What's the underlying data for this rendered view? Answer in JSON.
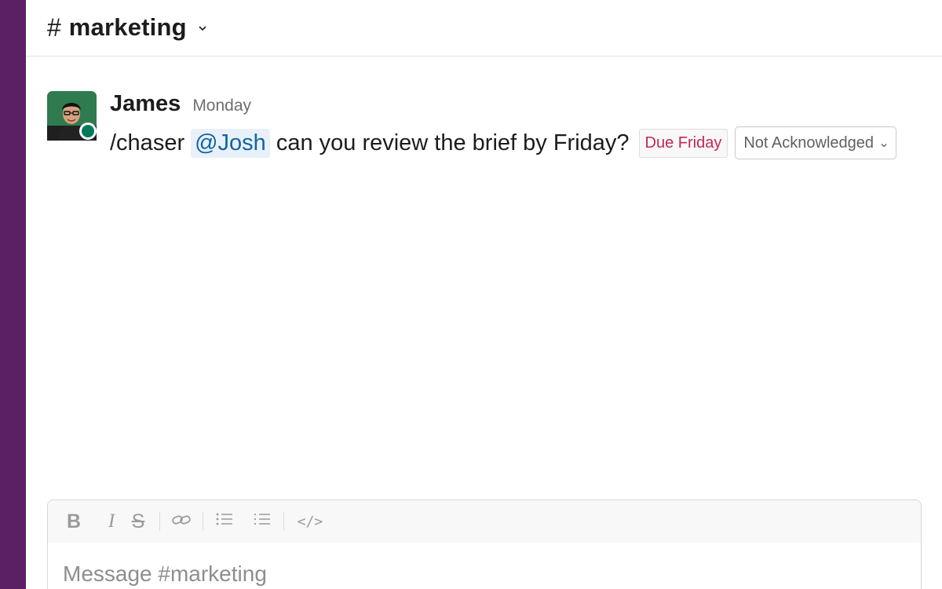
{
  "channel": {
    "hash_symbol": "#",
    "name": "marketing"
  },
  "message": {
    "author": "James",
    "timestamp": "Monday",
    "command": "/chaser",
    "mention": "@Josh",
    "text": "can you review the brief by Friday?",
    "due_badge": "Due Friday",
    "status_select": {
      "selected": "Not Acknowledged"
    }
  },
  "composer": {
    "toolbar": {
      "bold": "B",
      "italic": "I",
      "strike": "S",
      "code": "</>"
    },
    "placeholder": "Message #marketing"
  },
  "colors": {
    "sidebar": "#5b1f63",
    "mention_text": "#1264a3",
    "mention_bg": "#e8f1f9",
    "due_badge_text": "#c1275a",
    "presence": "#007a5a"
  },
  "icons": {
    "channel_chevron": "chevron-down-icon",
    "ack_chevron": "chevron-down-icon",
    "presence": "presence-indicator-icon",
    "link": "link-icon",
    "bulleted_list": "bulleted-list-icon",
    "numbered_list": "numbered-list-icon"
  }
}
